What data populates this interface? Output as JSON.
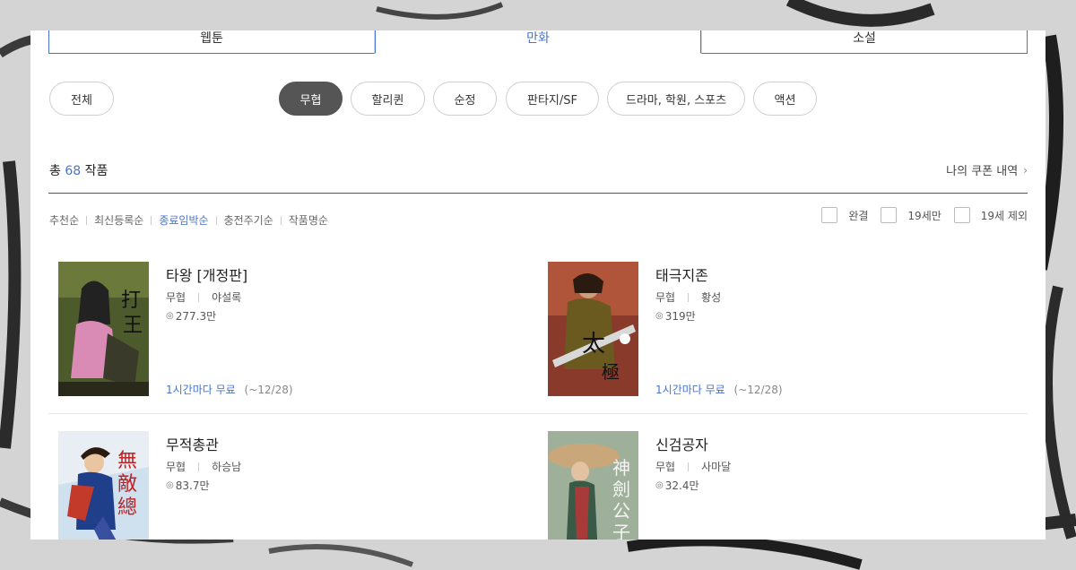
{
  "tabs": [
    {
      "label": "웹툰",
      "active": false
    },
    {
      "label": "만화",
      "active": true
    },
    {
      "label": "소설",
      "active": false
    }
  ],
  "chips": {
    "all": "전체",
    "genres": [
      {
        "label": "무협",
        "active": true
      },
      {
        "label": "할리퀸",
        "active": false
      },
      {
        "label": "순정",
        "active": false
      },
      {
        "label": "판타지/SF",
        "active": false
      },
      {
        "label": "드라마, 학원, 스포츠",
        "active": false
      },
      {
        "label": "액션",
        "active": false
      }
    ]
  },
  "summary": {
    "prefix": "총",
    "count": "68",
    "suffix": "작품",
    "coupon_link": "나의 쿠폰 내역"
  },
  "sort": [
    {
      "label": "추천순",
      "active": false
    },
    {
      "label": "최신등록순",
      "active": false
    },
    {
      "label": "종료임박순",
      "active": true
    },
    {
      "label": "충전주기순",
      "active": false
    },
    {
      "label": "작품명순",
      "active": false
    }
  ],
  "filters": [
    {
      "label": "완결",
      "checked": false
    },
    {
      "label": "19세만",
      "checked": false
    },
    {
      "label": "19세 제외",
      "checked": false
    }
  ],
  "works": [
    {
      "title": "타왕 [개정판]",
      "genre": "무협",
      "author": "야설록",
      "views": "277.3만",
      "promo_free": "1시간마다 무료",
      "promo_period": "(~12/28)"
    },
    {
      "title": "태극지존",
      "genre": "무협",
      "author": "황성",
      "views": "319만",
      "promo_free": "1시간마다 무료",
      "promo_period": "(~12/28)"
    },
    {
      "title": "무적총관",
      "genre": "무협",
      "author": "하승남",
      "views": "83.7만",
      "promo_free": "",
      "promo_period": ""
    },
    {
      "title": "신검공자",
      "genre": "무협",
      "author": "사마달",
      "views": "32.4만",
      "promo_free": "",
      "promo_period": ""
    }
  ],
  "icons": {
    "chevron": "chevron-right-icon",
    "views": "eye-icon"
  },
  "colors": {
    "accent": "#4a74c9",
    "chip_active": "#555555"
  }
}
